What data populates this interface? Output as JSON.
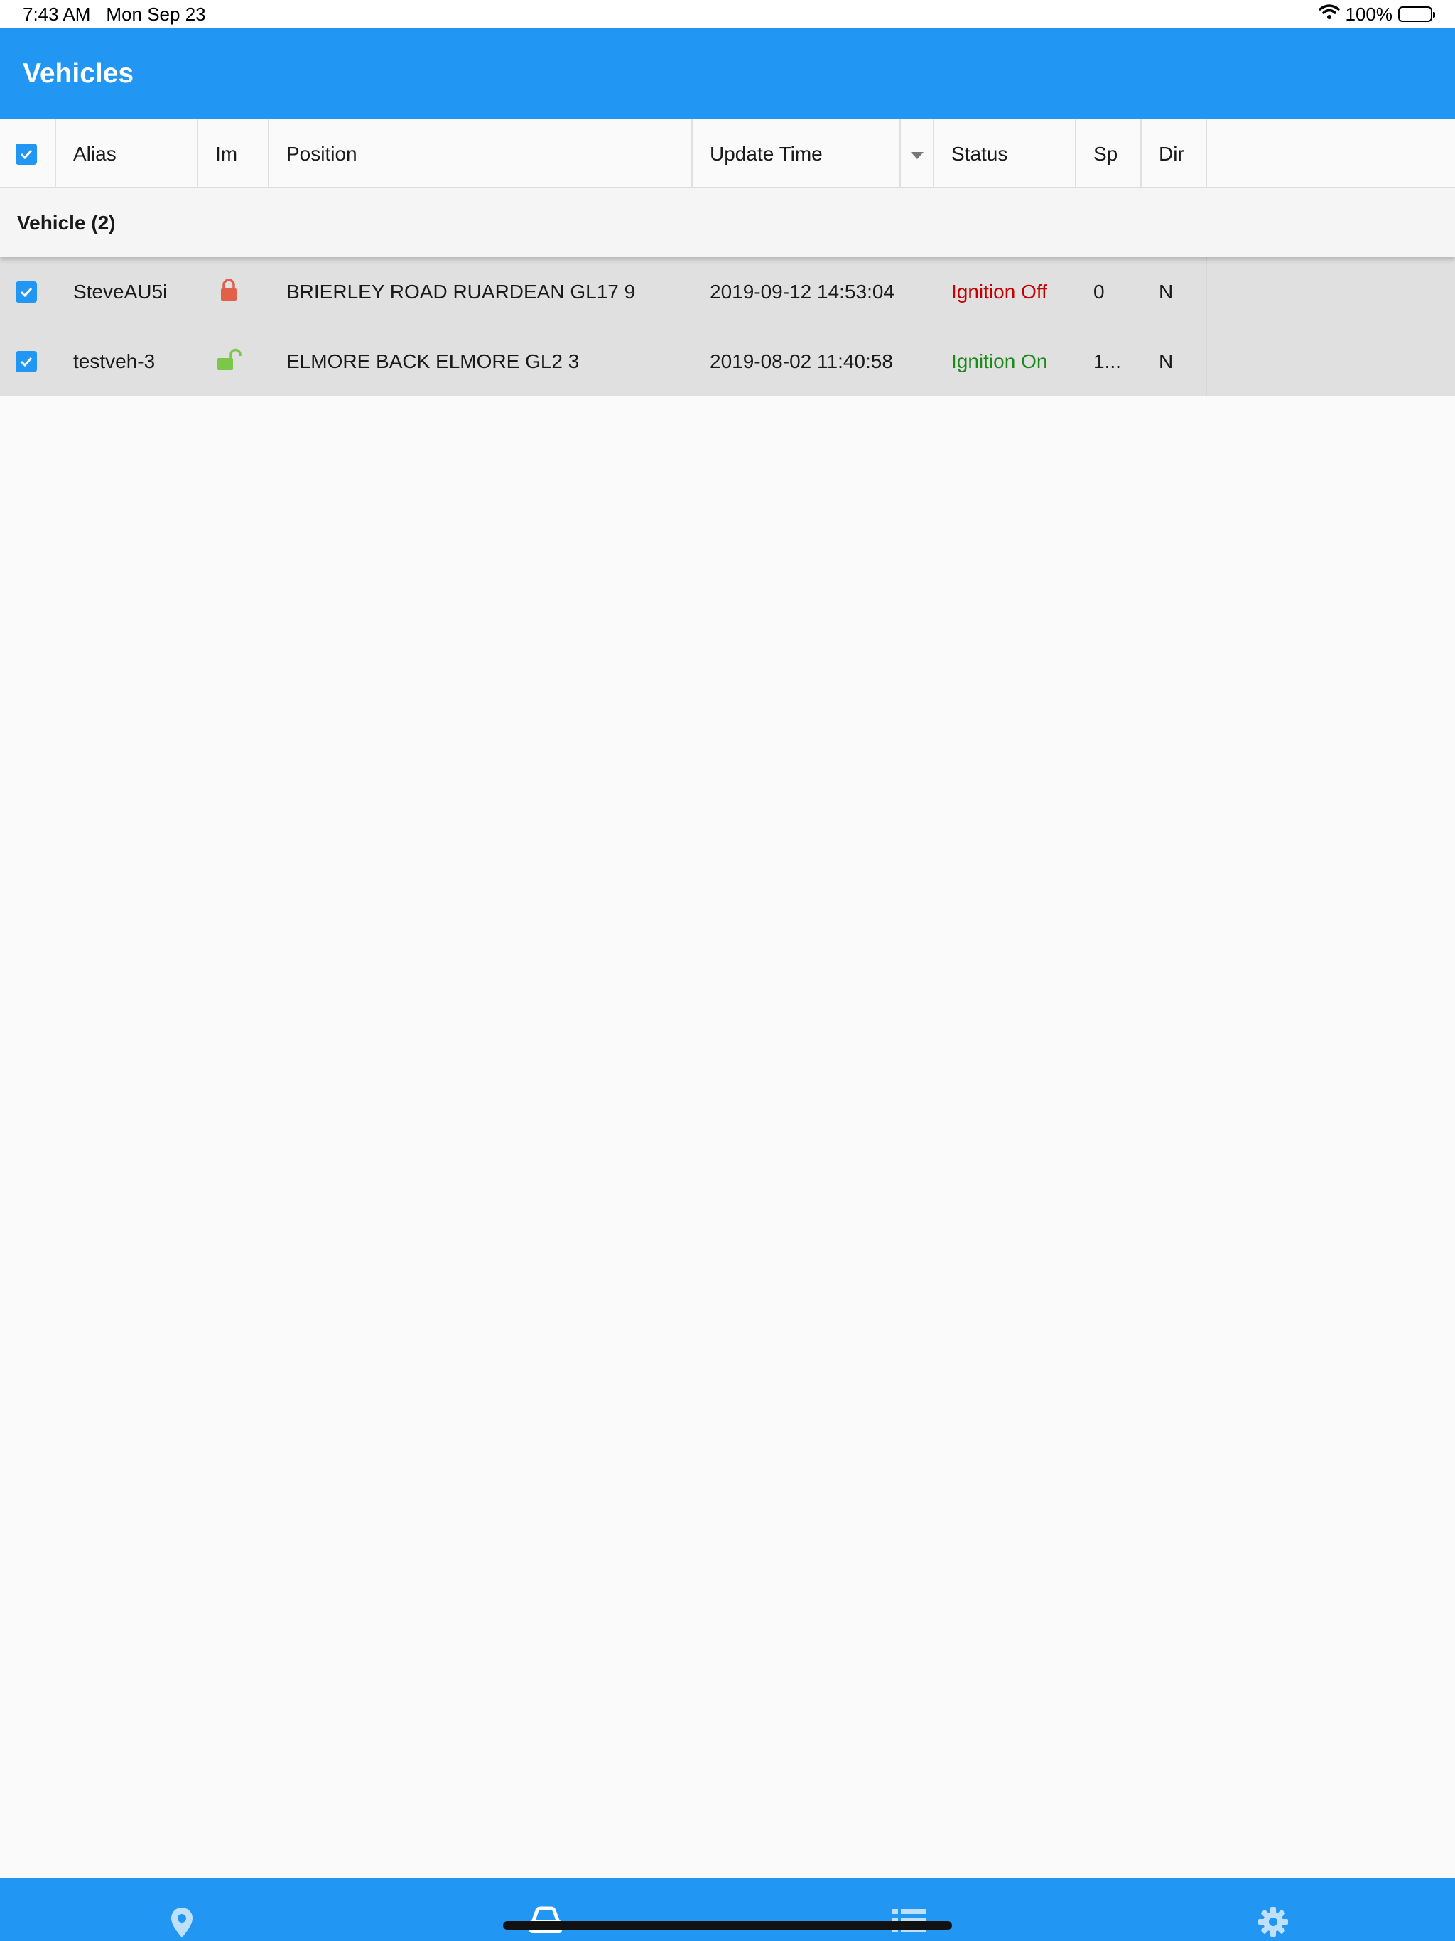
{
  "status_bar": {
    "time": "7:43 AM",
    "date": "Mon Sep 23",
    "battery": "100%"
  },
  "app_bar": {
    "title": "Vehicles"
  },
  "table": {
    "columns": [
      "Alias",
      "Im",
      "Position",
      "Update Time",
      "Status",
      "Sp",
      "Dir"
    ],
    "group_label": "Vehicle (2)",
    "rows": [
      {
        "alias": "SteveAU5i",
        "immobilizer": "locked",
        "position": "BRIERLEY ROAD RUARDEAN GL17 9",
        "update_time": "2019-09-12 14:53:04",
        "status": "Ignition Off",
        "speed": "0",
        "direction": "N"
      },
      {
        "alias": "testveh-3",
        "immobilizer": "unlocked",
        "position": "ELMORE BACK ELMORE GL2 3",
        "update_time": "2019-08-02 11:40:58",
        "status": "Ignition On",
        "speed": "1...",
        "direction": "N"
      }
    ]
  },
  "colors": {
    "primary": "#2196f3",
    "status_off": "#c40000",
    "status_on": "#1b8a1b",
    "lock_locked": "#e0604a",
    "lock_unlocked": "#7bc74a"
  },
  "bottom_nav": {
    "items": [
      "map-pin-icon",
      "car-icon",
      "list-icon",
      "gear-icon"
    ]
  }
}
